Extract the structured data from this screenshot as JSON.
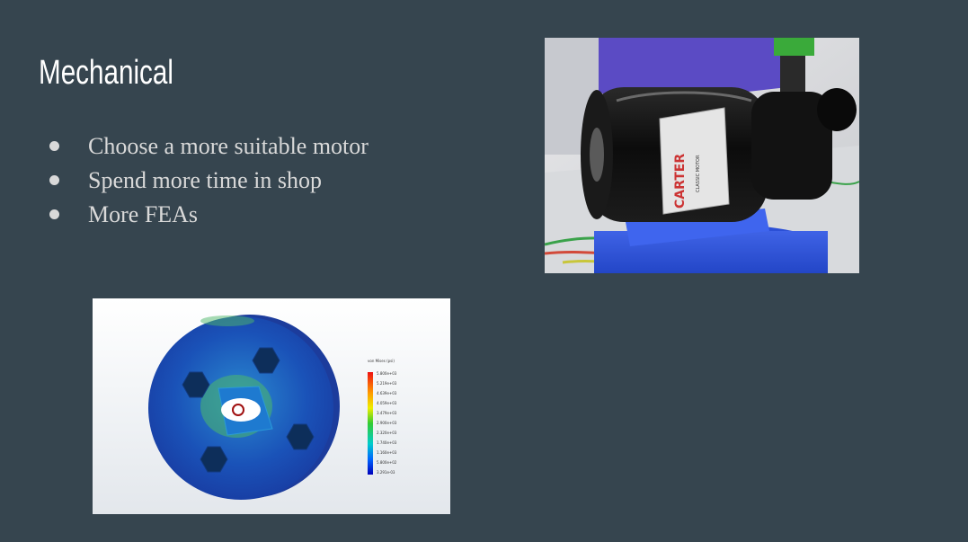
{
  "slide": {
    "title": "Mechanical",
    "bullets": [
      "Choose a more suitable motor",
      "Spend more time in shop",
      "More FEAs"
    ]
  },
  "motor_photo": {
    "label_brand": "CARTER",
    "label_subtitle": "CLASSIC MOTOR"
  },
  "fea_image": {
    "legend_title": "von Mises (psi)",
    "legend_values": [
      "5.800e+03",
      "5.219e+03",
      "4.639e+03",
      "4.059e+03",
      "3.479e+03",
      "2.900e+03",
      "2.320e+03",
      "1.740e+03",
      "1.160e+03",
      "5.800e+02",
      "3.291e-03"
    ]
  },
  "colors": {
    "background": "#36454f",
    "title": "#ffffff",
    "bullet_text": "#d9d9d9"
  }
}
